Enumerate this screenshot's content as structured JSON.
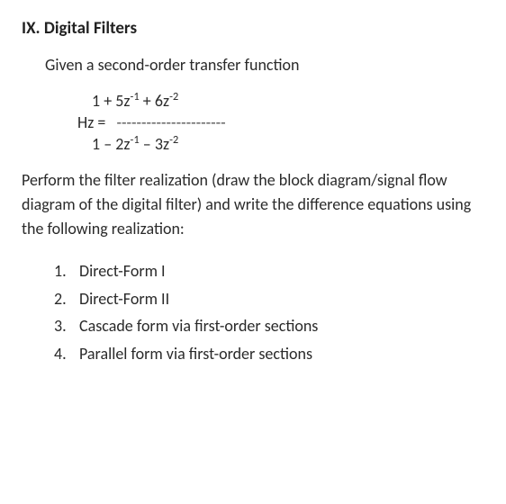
{
  "heading": "IX. Digital Filters",
  "given": "Given a second-order transfer function",
  "equation": {
    "lhs": "Hz = ",
    "num_plain": "1 + 5z⁻¹ + 6z⁻²",
    "dashes": "----------------------",
    "den_plain": "1 – 2z⁻¹ – 3z⁻²"
  },
  "perform": "Perform the filter realization (draw the block diagram/signal flow diagram of the digital filter) and write the difference equations using the following realization:",
  "items": [
    {
      "num": "1.",
      "label": "Direct-Form I"
    },
    {
      "num": "2.",
      "label": "Direct-Form II"
    },
    {
      "num": "3.",
      "label": "Cascade form via first-order sections"
    },
    {
      "num": "4.",
      "label": "Parallel form via first-order sections"
    }
  ],
  "chart_data": {
    "type": "table",
    "transfer_function": {
      "numerator_coeffs": [
        1,
        5,
        6
      ],
      "denominator_coeffs": [
        1,
        -2,
        -3
      ],
      "variable": "z^-1"
    },
    "realizations": [
      "Direct-Form I",
      "Direct-Form II",
      "Cascade form via first-order sections",
      "Parallel form via first-order sections"
    ]
  }
}
